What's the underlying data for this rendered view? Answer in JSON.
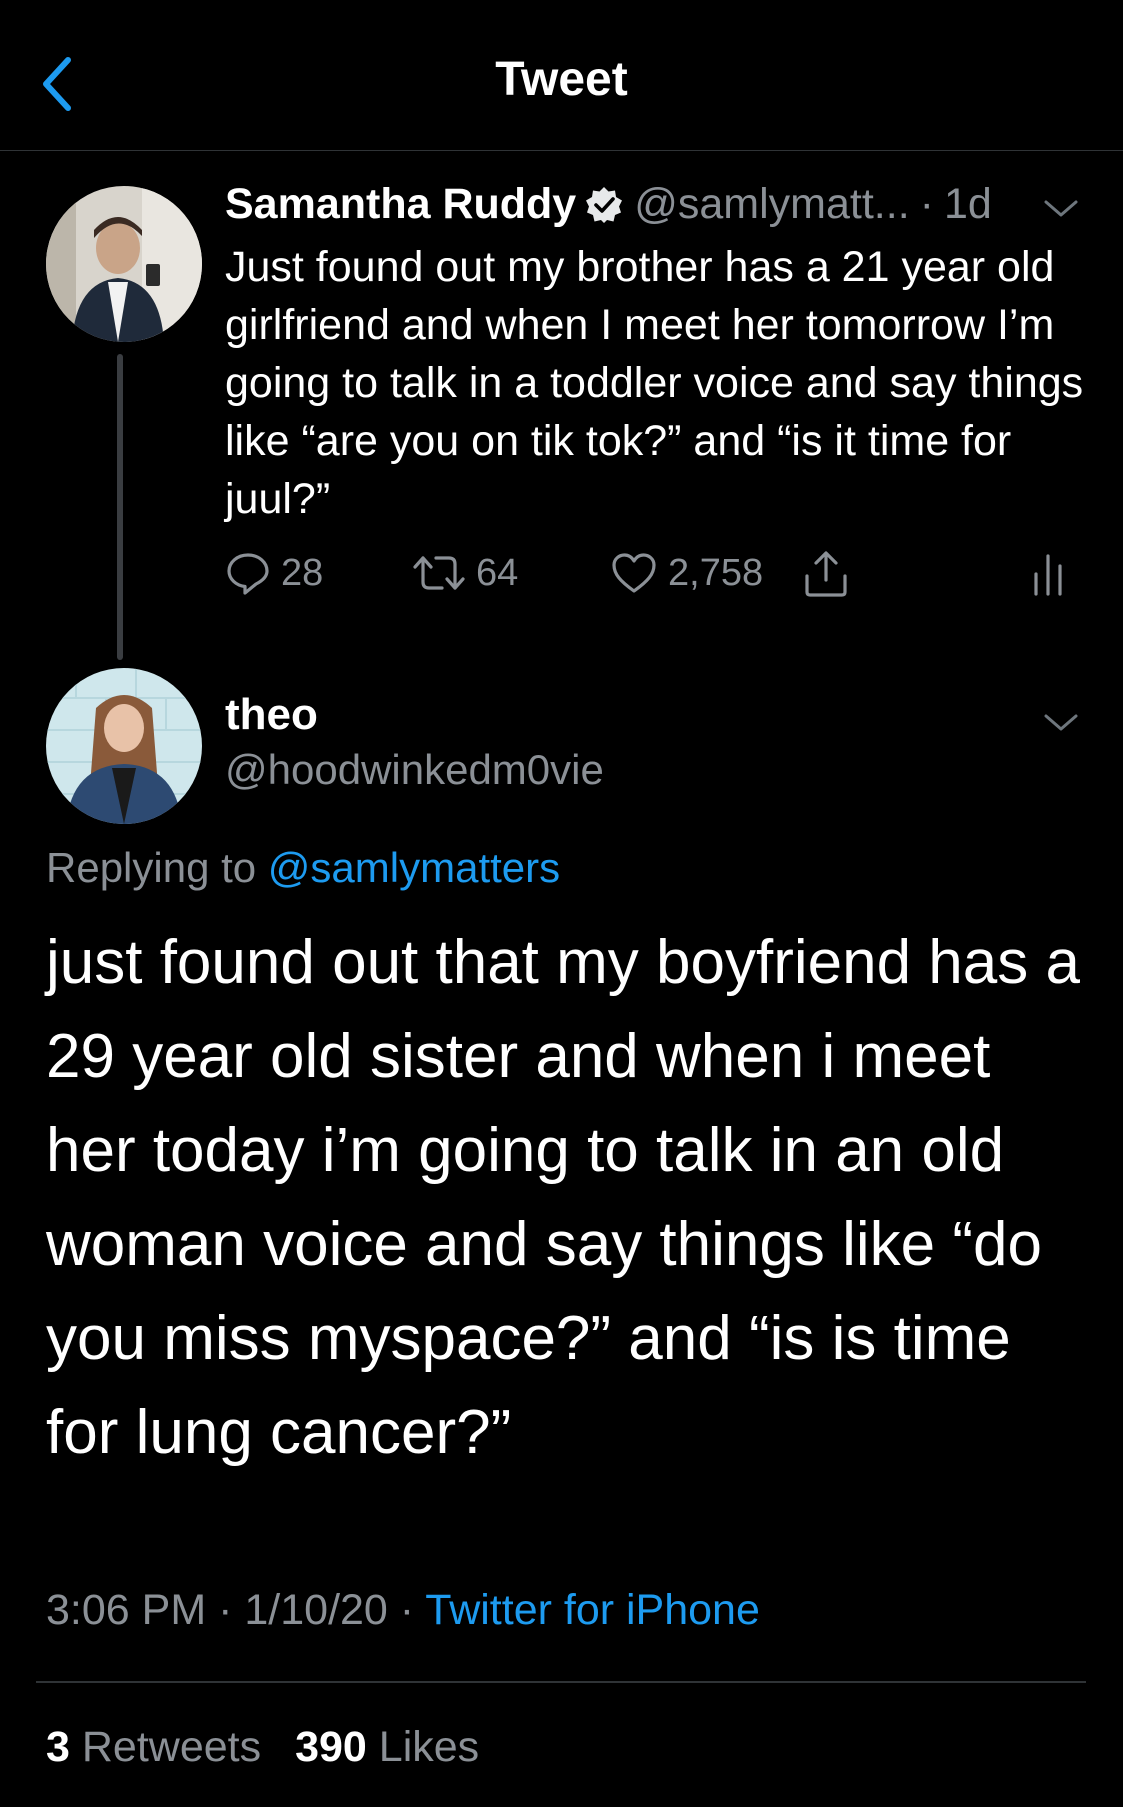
{
  "header": {
    "title": "Tweet"
  },
  "parent_tweet": {
    "name": "Samantha Ruddy",
    "handle": "@samlymatt...",
    "separator": "·",
    "time": "1d",
    "text": "Just found out my brother has a 21 year old girlfriend and when I meet her tomorrow I’m going to talk in a toddler voice and say things like “are you on tik tok?” and “is it time for juul?”",
    "replies": "28",
    "retweets": "64",
    "likes": "2,758"
  },
  "reply_tweet": {
    "name": "theo",
    "handle": "@hoodwinkedm0vie",
    "replying_prefix": "Replying to",
    "replying_to": "@samlymatters",
    "text": "just found out that my boyfriend has a 29 year old sister and when i meet her today i’m going to talk in an old woman voice and say things like “do you miss myspace?” and “is is time for lung cancer?”",
    "time": "3:06 PM",
    "date": "1/10/20",
    "dot": "·",
    "source": "Twitter for iPhone",
    "retweets_count": "3",
    "retweets_label": "Retweets",
    "likes_count": "390",
    "likes_label": "Likes"
  },
  "colors": {
    "background": "#000000",
    "accent": "#1d9bf0",
    "secondary_text": "#8b9096"
  },
  "icons": [
    "back-chevron-icon",
    "verified-badge-icon",
    "chevron-down-icon",
    "reply-icon",
    "retweet-icon",
    "like-icon",
    "share-icon",
    "analytics-icon"
  ]
}
